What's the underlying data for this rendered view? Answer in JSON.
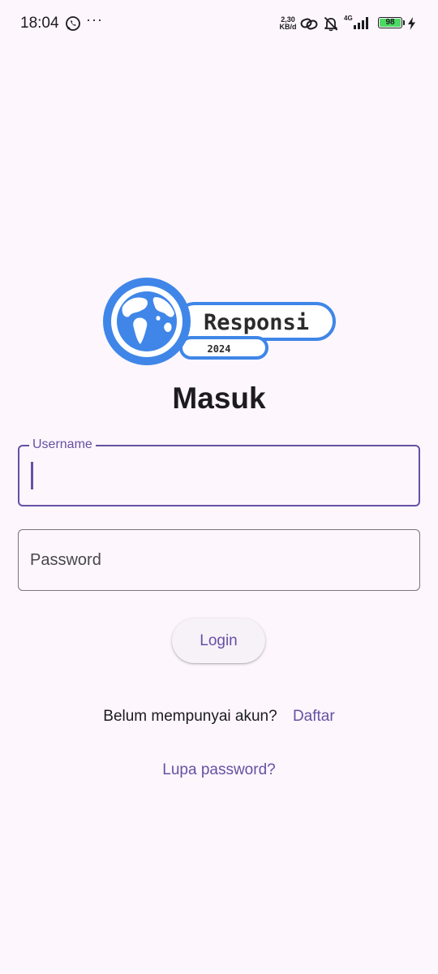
{
  "status_bar": {
    "time": "18:04",
    "more": "···",
    "net_speed_value": "2,30",
    "net_speed_unit": "KB/d",
    "network_type": "4G",
    "battery": "98",
    "icons": [
      "whatsapp-icon",
      "link-icon",
      "bell-off-icon",
      "signal-icon",
      "battery-icon",
      "charging-icon"
    ]
  },
  "logo": {
    "text": "Responsi",
    "year": "2024",
    "icon": "globe-icon"
  },
  "title": "Masuk",
  "form": {
    "username_label": "Username",
    "username_value": "",
    "password_placeholder": "Password",
    "password_value": "",
    "login_label": "Login"
  },
  "register": {
    "prompt": "Belum mempunyai akun?",
    "link": "Daftar"
  },
  "forgot_password": "Lupa password?",
  "colors": {
    "primary": "#6750a4",
    "background": "#fdf6fc",
    "logo_blue": "#3f86e8",
    "outline": "#79747e"
  }
}
